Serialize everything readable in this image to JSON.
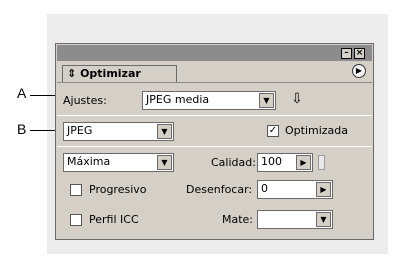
{
  "callouts": {
    "a": "A",
    "b": "B"
  },
  "window": {
    "minimize_icon": "minimize-icon",
    "close_icon": "close-icon"
  },
  "tab": {
    "label": "Optimizar",
    "icon": "updown-arrows-icon",
    "menu_icon": "panel-menu-icon"
  },
  "settings": {
    "ajustes_label": "Ajustes:",
    "ajustes_value": "JPEG media",
    "settings_icon": "optimize-settings-icon"
  },
  "format": {
    "value": "JPEG",
    "optimized_label": "Optimizada",
    "optimized_checked": true
  },
  "quality": {
    "preset": "Máxima",
    "calidad_label": "Calidad:",
    "calidad_value": "100"
  },
  "progressive": {
    "label": "Progresivo",
    "checked": false
  },
  "blur": {
    "label": "Desenfocar:",
    "value": "0"
  },
  "icc": {
    "label": "Perfil ICC",
    "checked": false
  },
  "matte": {
    "label": "Mate:",
    "value": ""
  },
  "colors": {
    "panel_bg": "#d4d0c8",
    "titlebar": "#8c8c8c"
  }
}
